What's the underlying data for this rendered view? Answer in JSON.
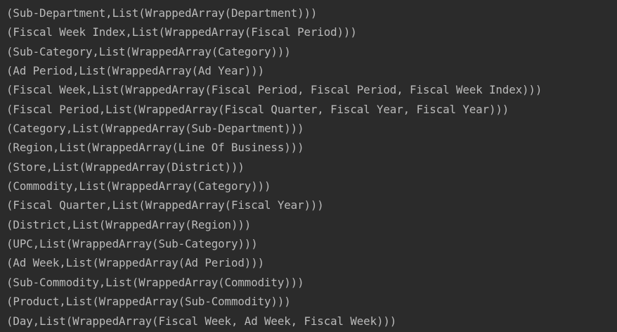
{
  "console": {
    "lines": [
      "(Sub-Department,List(WrappedArray(Department)))",
      "(Fiscal Week Index,List(WrappedArray(Fiscal Period)))",
      "(Sub-Category,List(WrappedArray(Category)))",
      "(Ad Period,List(WrappedArray(Ad Year)))",
      "(Fiscal Week,List(WrappedArray(Fiscal Period, Fiscal Period, Fiscal Week Index)))",
      "(Fiscal Period,List(WrappedArray(Fiscal Quarter, Fiscal Year, Fiscal Year)))",
      "(Category,List(WrappedArray(Sub-Department)))",
      "(Region,List(WrappedArray(Line Of Business)))",
      "(Store,List(WrappedArray(District)))",
      "(Commodity,List(WrappedArray(Category)))",
      "(Fiscal Quarter,List(WrappedArray(Fiscal Year)))",
      "(District,List(WrappedArray(Region)))",
      "(UPC,List(WrappedArray(Sub-Category)))",
      "(Ad Week,List(WrappedArray(Ad Period)))",
      "(Sub-Commodity,List(WrappedArray(Commodity)))",
      "(Product,List(WrappedArray(Sub-Commodity)))",
      "(Day,List(WrappedArray(Fiscal Week, Ad Week, Fiscal Week)))"
    ]
  }
}
